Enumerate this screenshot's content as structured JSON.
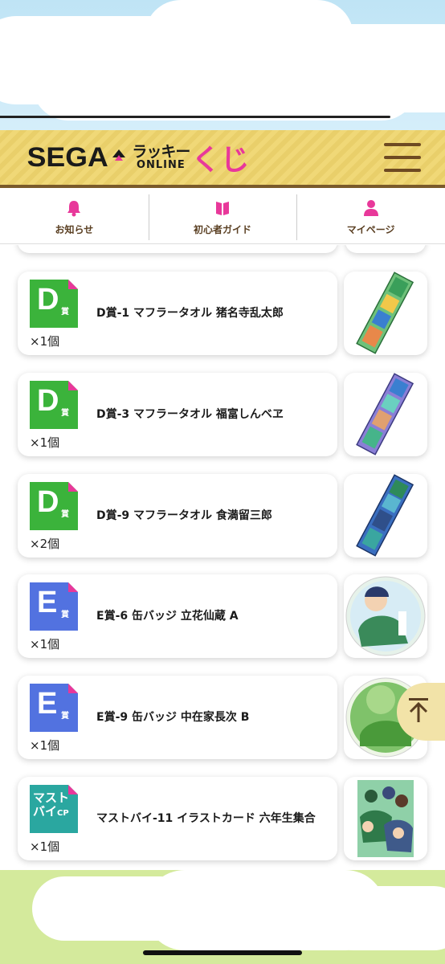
{
  "header": {
    "logo_sega": "SEGA",
    "logo_lucky": "ラッキー",
    "logo_online": "ONLINE",
    "logo_kuji": "くじ"
  },
  "tabs": [
    {
      "label": "お知らせ",
      "icon": "bell-icon"
    },
    {
      "label": "初心者ガイド",
      "icon": "book-icon"
    },
    {
      "label": "マイページ",
      "icon": "person-icon"
    }
  ],
  "items": [
    {
      "badge_type": "D",
      "badge_letter": "D",
      "badge_sub": "賞",
      "badge_color": "#3bb33b",
      "name": "D賞-1 マフラータオル 猪名寺乱太郎",
      "qty": "×1個",
      "thumb": "towel"
    },
    {
      "badge_type": "D",
      "badge_letter": "D",
      "badge_sub": "賞",
      "badge_color": "#3bb33b",
      "name": "D賞-3 マフラータオル 福富しんベヱ",
      "qty": "×1個",
      "thumb": "towel"
    },
    {
      "badge_type": "D",
      "badge_letter": "D",
      "badge_sub": "賞",
      "badge_color": "#3bb33b",
      "name": "D賞-9 マフラータオル 食満留三郎",
      "qty": "×2個",
      "thumb": "towel"
    },
    {
      "badge_type": "E",
      "badge_letter": "E",
      "badge_sub": "賞",
      "badge_color": "#5272e0",
      "name": "E賞-6 缶バッジ 立花仙蔵 A",
      "qty": "×1個",
      "thumb": "badge"
    },
    {
      "badge_type": "E",
      "badge_letter": "E",
      "badge_sub": "賞",
      "badge_color": "#5272e0",
      "name": "E賞-9 缶バッジ 中在家長次 B",
      "qty": "×1個",
      "thumb": "badge"
    },
    {
      "badge_type": "CP",
      "badge_line1": "マスト",
      "badge_line2": "バイ",
      "badge_cp": "CP",
      "badge_color": "#2aa7a0",
      "name": "マストバイ-11 イラストカード 六年生集合",
      "qty": "×1個",
      "thumb": "card"
    }
  ],
  "scroll_top": {
    "icon": "arrow-up-icon"
  },
  "colors": {
    "accent_pink": "#e8389a",
    "header_gold": "#f0d877",
    "header_brown": "#6e4a22",
    "badge_green": "#3bb33b",
    "badge_blue": "#5272e0",
    "badge_teal": "#2aa7a0"
  }
}
